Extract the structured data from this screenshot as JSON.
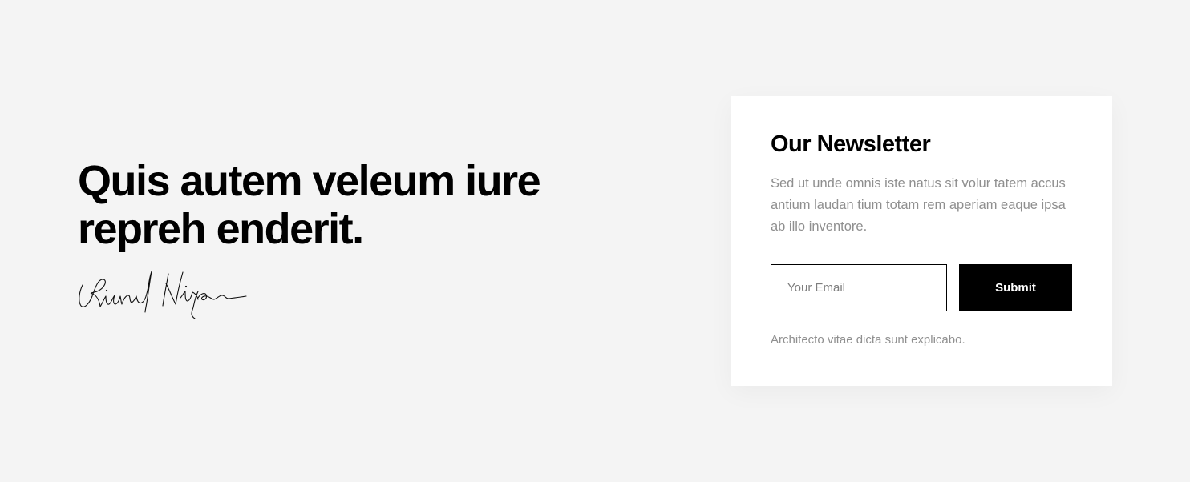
{
  "hero": {
    "headline_line1": "Quis autem veleum iure",
    "headline_line2": "repreh enderit.",
    "signature_icon": "handwritten-signature"
  },
  "newsletter": {
    "title": "Our Newsletter",
    "description": "Sed ut unde omnis iste natus sit volur tatem accus antium laudan tium totam rem aperiam eaque ipsa ab illo inventore.",
    "email_placeholder": "Your Email",
    "email_value": "",
    "submit_label": "Submit",
    "note": "Architecto vitae dicta sunt explicabo."
  },
  "colors": {
    "background": "#f4f4f4",
    "card": "#ffffff",
    "text": "#000000",
    "muted": "#8f8f8f",
    "button": "#000000"
  }
}
